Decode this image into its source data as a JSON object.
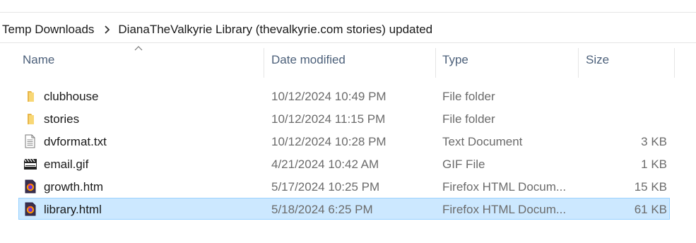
{
  "breadcrumb": {
    "items": [
      "Temp Downloads",
      "DianaTheValkyrie Library (thevalkyrie.com stories) updated"
    ]
  },
  "columns": {
    "name": "Name",
    "date": "Date modified",
    "type": "Type",
    "size": "Size"
  },
  "files": [
    {
      "name": "clubhouse",
      "date": "10/12/2024 10:49 PM",
      "type": "File folder",
      "size": "",
      "icon": "folder-icon"
    },
    {
      "name": "stories",
      "date": "10/12/2024 11:15 PM",
      "type": "File folder",
      "size": "",
      "icon": "folder-icon"
    },
    {
      "name": "dvformat.txt",
      "date": "10/12/2024 10:28 PM",
      "type": "Text Document",
      "size": "3 KB",
      "icon": "text-file-icon"
    },
    {
      "name": "email.gif",
      "date": "4/21/2024 10:42 AM",
      "type": "GIF File",
      "size": "1 KB",
      "icon": "media-file-icon"
    },
    {
      "name": "growth.htm",
      "date": "5/17/2024 10:25 PM",
      "type": "Firefox HTML Docum...",
      "size": "15 KB",
      "icon": "firefox-html-icon"
    },
    {
      "name": "library.html",
      "date": "5/18/2024 6:25 PM",
      "type": "Firefox HTML Docum...",
      "size": "61 KB",
      "icon": "firefox-html-icon",
      "selected": true
    }
  ],
  "colors": {
    "selection_bg": "#cce8ff",
    "selection_border": "#99d1ff",
    "header_text": "#4c607a",
    "folder": "#f8d775"
  }
}
